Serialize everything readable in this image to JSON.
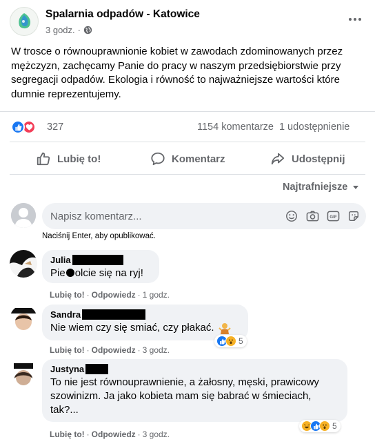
{
  "post": {
    "page_name": "Spalarnia odpadów - Katowice",
    "time": "3 godz.",
    "text": "W trosce o równouprawnionie kobiet w zawodach zdominowanych przez mężczyzn, zachęcamy Panie do pracy w naszym przedsiębiorstwie przy segregacji odpadów. Ekologia i równość to najważniejsze wartości które dumnie reprezentujemy."
  },
  "stats": {
    "reactions_count": "327",
    "comments": "1154 komentarze",
    "shares": "1 udostępnienie",
    "reaction_icons": [
      "like-icon",
      "love-icon"
    ]
  },
  "actions": {
    "like": "Lubię to!",
    "comment": "Komentarz",
    "share": "Udostępnij"
  },
  "sort": {
    "label": "Najtrafniejsze"
  },
  "composer": {
    "placeholder": "Napisz komentarz...",
    "hint": "Naciśnij Enter, aby opublikować.",
    "icons": [
      "emoji-icon",
      "camera-icon",
      "gif-icon",
      "sticker-icon"
    ]
  },
  "comments": [
    {
      "author": "Julia",
      "text_a": "Pie",
      "text_b": "olcie się na ryj!",
      "like": "Lubię to!",
      "reply": "Odpowiedz",
      "time": "1 godz."
    },
    {
      "author": "Sandra",
      "text": "Nie wiem czy się smiać, czy płakać.",
      "like": "Lubię to!",
      "reply": "Odpowiedz",
      "time": "3 godz.",
      "reaction_count": "5"
    },
    {
      "author": "Justyna",
      "text": "To nie jest równouprawnienie, a żałosny, męski, prawicowy szowinizm. Ja jako kobieta mam się babrać w śmieciach, tak?...",
      "like": "Lubię to!",
      "reply": "Odpowiedz",
      "time": "3 godz.",
      "reaction_count": "5"
    }
  ],
  "colors": {
    "like_blue": "#1877f2",
    "love_red": "#f33e58",
    "haha_yellow": "#f7b125",
    "secondary_text": "#65676b",
    "bubble_bg": "#f0f2f5"
  }
}
